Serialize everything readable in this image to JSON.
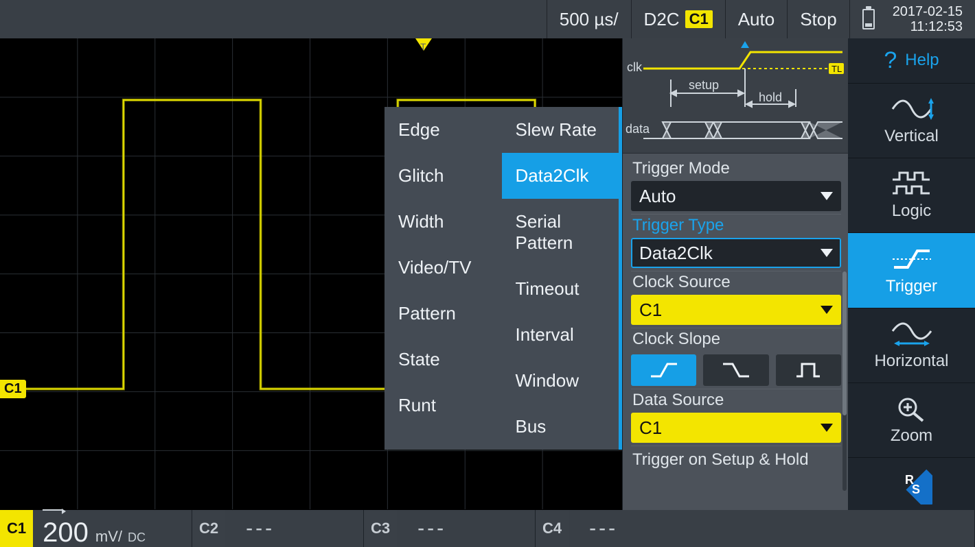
{
  "topbar": {
    "timebase": "500 µs/",
    "trigger_rel": "D2C",
    "trigger_ch": "C1",
    "mode": "Auto",
    "runstate": "Stop",
    "date": "2017-02-15",
    "time": "11:12:53"
  },
  "waveform": {
    "channel_tag": "C1",
    "level_tag": "TL"
  },
  "popup": {
    "col1": [
      "Edge",
      "Glitch",
      "Width",
      "Video/TV",
      "Pattern",
      "State",
      "Runt"
    ],
    "col2": [
      "Slew Rate",
      "Data2Clk",
      "Serial Pattern",
      "Timeout",
      "Interval",
      "Window",
      "Bus"
    ],
    "selected": "Data2Clk"
  },
  "diagram": {
    "clk": "clk",
    "data": "data",
    "setup": "setup",
    "hold": "hold",
    "tl": "TL"
  },
  "config": {
    "trigger_mode": {
      "label": "Trigger Mode",
      "value": "Auto"
    },
    "trigger_type": {
      "label": "Trigger Type",
      "value": "Data2Clk"
    },
    "clock_source": {
      "label": "Clock Source",
      "value": "C1"
    },
    "clock_slope": {
      "label": "Clock Slope",
      "selected": 0
    },
    "data_source": {
      "label": "Data Source",
      "value": "C1"
    },
    "setup_hold": {
      "label": "Trigger on Setup & Hold"
    }
  },
  "sidenav": {
    "help": "Help",
    "items": [
      "Vertical",
      "Logic",
      "Trigger",
      "Horizontal",
      "Zoom"
    ],
    "active": "Trigger"
  },
  "bottom": {
    "c1": {
      "tag": "C1",
      "value": "200",
      "unit": "mV/",
      "coupling": "DC"
    },
    "others": [
      {
        "tag": "C2",
        "text": "---"
      },
      {
        "tag": "C3",
        "text": "---"
      },
      {
        "tag": "C4",
        "text": "---"
      }
    ]
  }
}
